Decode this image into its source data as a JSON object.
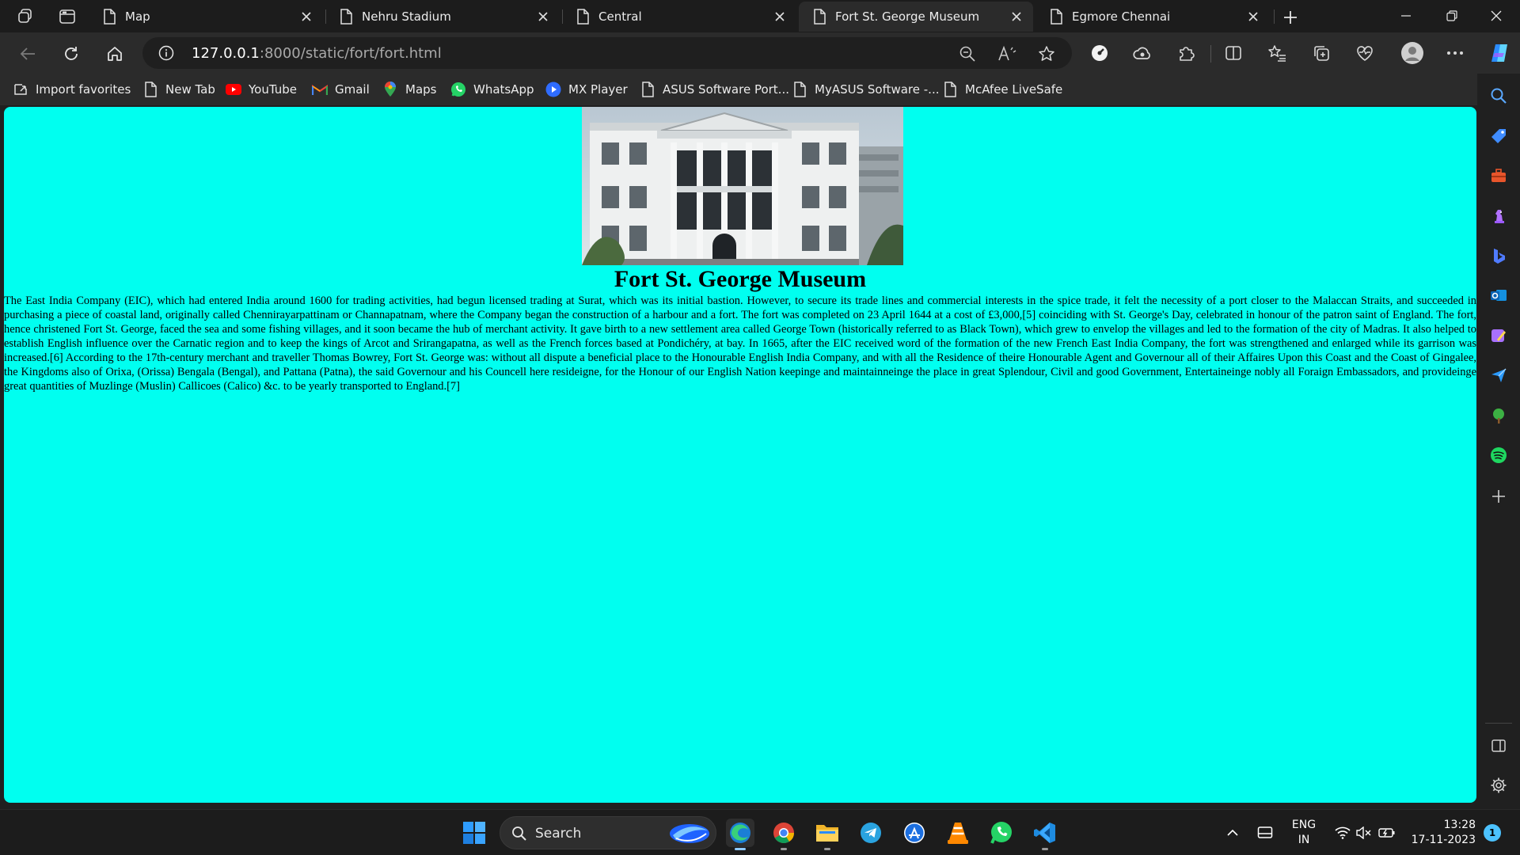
{
  "browser": {
    "tabs": [
      {
        "label": "Map",
        "active": false
      },
      {
        "label": "Nehru Stadium",
        "active": false
      },
      {
        "label": "Central",
        "active": false
      },
      {
        "label": "Fort St. George Museum",
        "active": true
      },
      {
        "label": "Egmore Chennai",
        "active": false
      }
    ],
    "address": {
      "host": "127.0.0.1",
      "path": ":8000/static/fort/fort.html"
    },
    "favorites": [
      {
        "label": "Import favorites",
        "icon": "import-icon"
      },
      {
        "label": "New Tab",
        "icon": "page-icon"
      },
      {
        "label": "YouTube",
        "icon": "youtube-icon"
      },
      {
        "label": "Gmail",
        "icon": "gmail-icon"
      },
      {
        "label": "Maps",
        "icon": "maps-icon"
      },
      {
        "label": "WhatsApp",
        "icon": "whatsapp-icon"
      },
      {
        "label": "MX Player",
        "icon": "mx-player-icon"
      },
      {
        "label": "ASUS Software Port...",
        "icon": "page-icon"
      },
      {
        "label": "MyASUS Software -...",
        "icon": "page-icon"
      },
      {
        "label": "McAfee LiveSafe",
        "icon": "page-icon"
      }
    ]
  },
  "page": {
    "title": "Fort St. George Museum",
    "body": "The East India Company (EIC), which had entered India around 1600 for trading activities, had begun licensed trading at Surat, which was its initial bastion. However, to secure its trade lines and commercial interests in the spice trade, it felt the necessity of a port closer to the Malaccan Straits, and succeeded in purchasing a piece of coastal land, originally called Chennirayarpattinam or Channapatnam, where the Company began the construction of a harbour and a fort. The fort was completed on 23 April 1644 at a cost of £3,000,[5] coinciding with St. George's Day, celebrated in honour of the patron saint of England. The fort, hence christened Fort St. George, faced the sea and some fishing villages, and it soon became the hub of merchant activity. It gave birth to a new settlement area called George Town (historically referred to as Black Town), which grew to envelop the villages and led to the formation of the city of Madras. It also helped to establish English influence over the Carnatic region and to keep the kings of Arcot and Srirangapatna, as well as the French forces based at Pondichéry, at bay. In 1665, after the EIC received word of the formation of the new French East India Company, the fort was strengthened and enlarged while its garrison was increased.[6] According to the 17th-century merchant and traveller Thomas Bowrey, Fort St. George was: without all dispute a beneficial place to the Honourable English India Company, and with all the Residence of theire Honourable Agent and Governour all of their Affaires Upon this Coast and the Coast of Gingalee, the Kingdoms also of Orixa, (Orissa) Bengala (Bengal), and Pattana (Patna), the said Governour and his Councell here resideigne, for the Honour of our English Nation keepinge and maintainneinge the place in great Splendour, Civil and good Government, Entertaineinge nobly all Foraign Embassadors, and provideinge great quantities of Muzlinge (Muslin) Callicoes (Calico) &c. to be yearly transported to England.[7]",
    "background": "#00fff0"
  },
  "taskbar": {
    "search_label": "Search",
    "language": {
      "line1": "ENG",
      "line2": "IN"
    },
    "clock": {
      "time": "13:28",
      "date": "17-11-2023"
    },
    "notification_count": "1"
  }
}
